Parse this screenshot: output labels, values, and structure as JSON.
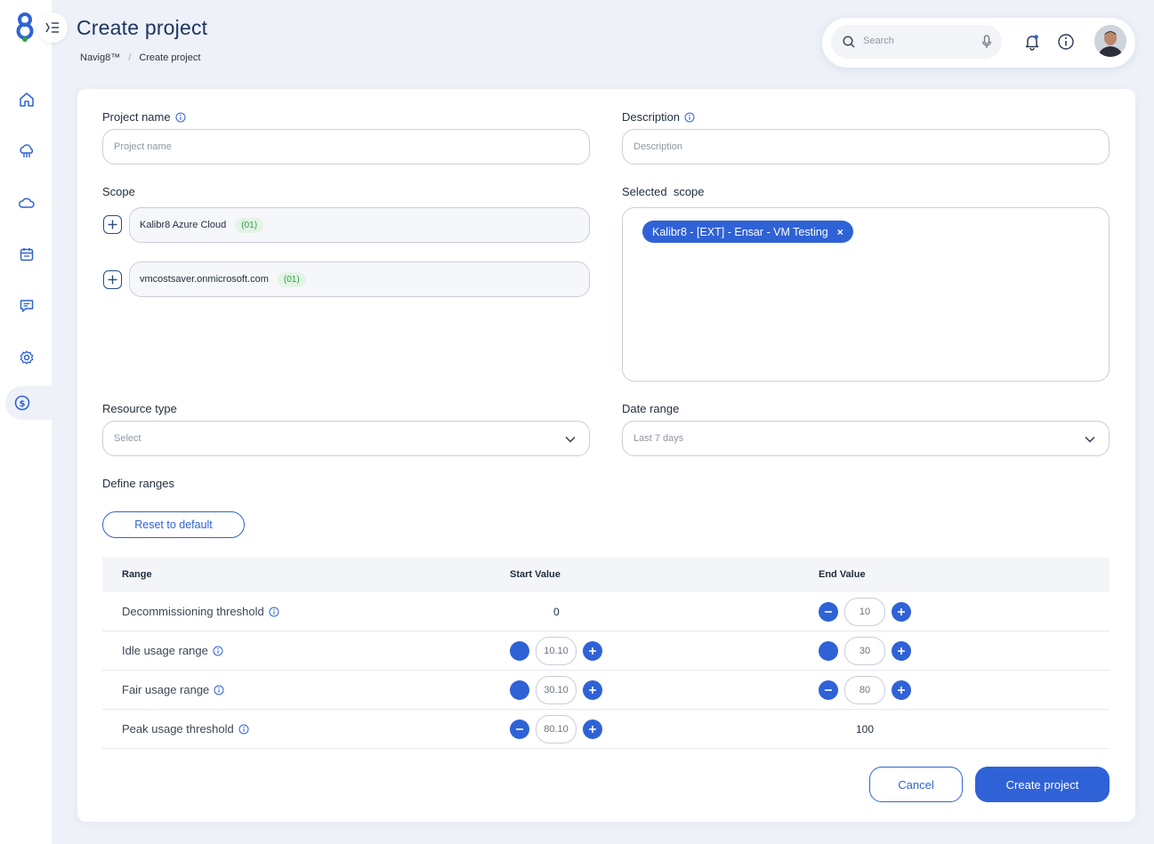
{
  "app": {
    "title": "Create project",
    "breadcrumb": [
      "Navig8™",
      "Create project"
    ],
    "colors": {
      "accent": "#2f62d6",
      "navy": "#1e3560",
      "badge_green": "#2f9e44"
    }
  },
  "sidebar": {
    "items": [
      {
        "icon": "home-icon"
      },
      {
        "icon": "cloud-network-icon"
      },
      {
        "icon": "cloud-icon"
      },
      {
        "icon": "calendar-icon"
      },
      {
        "icon": "chat-icon"
      },
      {
        "icon": "settings-icon"
      },
      {
        "icon": "dollar-icon",
        "active": true
      }
    ]
  },
  "topbar": {
    "search_placeholder": "Search"
  },
  "form": {
    "project_name": {
      "label": "Project name",
      "placeholder": "Project name"
    },
    "description": {
      "label": "Description",
      "placeholder": "Description"
    },
    "scope": {
      "label": "Scope",
      "items": [
        {
          "name": "Kalibr8 Azure Cloud",
          "count": "(01)"
        },
        {
          "name": "vmcostsaver.onmicrosoft.com",
          "count": "(01)"
        }
      ]
    },
    "selected_scope": {
      "label": "Selected  scope",
      "chips": [
        "Kalibr8 - [EXT] - Ensar - VM Testing"
      ]
    },
    "resource_type": {
      "label": "Resource type",
      "placeholder": "Select"
    },
    "date_range": {
      "label": "Date range",
      "value": "Last 7 days"
    },
    "define_ranges": {
      "label": "Define ranges",
      "reset_label": "Reset to default"
    }
  },
  "ranges_table": {
    "headers": [
      "Range",
      "Start Value",
      "End Value"
    ],
    "rows": [
      {
        "name": "Decommissioning threshold",
        "start": "0",
        "end": "10"
      },
      {
        "name": "Idle usage range",
        "start": "10.10",
        "end": "30"
      },
      {
        "name": "Fair usage range",
        "start": "30.10",
        "end": "80"
      },
      {
        "name": "Peak usage threshold",
        "start": "80.10",
        "end": "100"
      }
    ]
  },
  "actions": {
    "cancel": "Cancel",
    "create": "Create project"
  }
}
